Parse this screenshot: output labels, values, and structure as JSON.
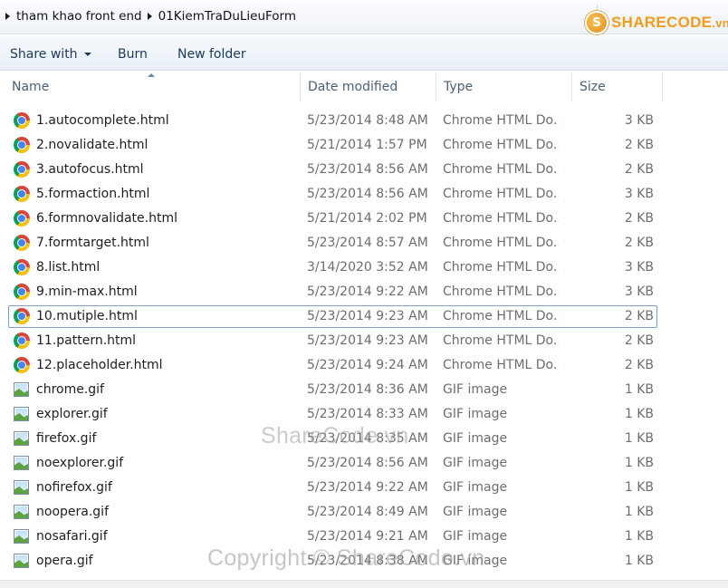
{
  "address_bar": {
    "crumbs": [
      "tham khao front end",
      "01KiemTraDuLieuForm"
    ]
  },
  "logo": {
    "badge": "S",
    "name": "SHARECODE",
    "tld": ".vn"
  },
  "toolbar": {
    "share_label": "Share with",
    "burn_label": "Burn",
    "new_folder_label": "New folder"
  },
  "columns": {
    "name": "Name",
    "date": "Date modified",
    "type": "Type",
    "size": "Size"
  },
  "files": [
    {
      "name": "1.autocomplete.html",
      "date": "5/23/2014 8:48 AM",
      "type": "Chrome HTML Do...",
      "size": "3 KB",
      "icon": "chrome-icon"
    },
    {
      "name": "2.novalidate.html",
      "date": "5/21/2014 1:57 PM",
      "type": "Chrome HTML Do...",
      "size": "2 KB",
      "icon": "chrome-icon"
    },
    {
      "name": "3.autofocus.html",
      "date": "5/23/2014 8:56 AM",
      "type": "Chrome HTML Do...",
      "size": "2 KB",
      "icon": "chrome-icon"
    },
    {
      "name": "5.formaction.html",
      "date": "5/23/2014 8:56 AM",
      "type": "Chrome HTML Do...",
      "size": "3 KB",
      "icon": "chrome-icon"
    },
    {
      "name": "6.formnovalidate.html",
      "date": "5/21/2014 2:02 PM",
      "type": "Chrome HTML Do...",
      "size": "2 KB",
      "icon": "chrome-icon"
    },
    {
      "name": "7.formtarget.html",
      "date": "5/23/2014 8:57 AM",
      "type": "Chrome HTML Do...",
      "size": "2 KB",
      "icon": "chrome-icon"
    },
    {
      "name": "8.list.html",
      "date": "3/14/2020 3:52 AM",
      "type": "Chrome HTML Do...",
      "size": "3 KB",
      "icon": "chrome-icon"
    },
    {
      "name": "9.min-max.html",
      "date": "5/23/2014 9:22 AM",
      "type": "Chrome HTML Do...",
      "size": "3 KB",
      "icon": "chrome-icon"
    },
    {
      "name": "10.mutiple.html",
      "date": "5/23/2014 9:23 AM",
      "type": "Chrome HTML Do...",
      "size": "2 KB",
      "icon": "chrome-icon",
      "selected": true
    },
    {
      "name": "11.pattern.html",
      "date": "5/23/2014 9:23 AM",
      "type": "Chrome HTML Do...",
      "size": "2 KB",
      "icon": "chrome-icon"
    },
    {
      "name": "12.placeholder.html",
      "date": "5/23/2014 9:24 AM",
      "type": "Chrome HTML Do...",
      "size": "2 KB",
      "icon": "chrome-icon"
    },
    {
      "name": "chrome.gif",
      "date": "5/23/2014 8:36 AM",
      "type": "GIF image",
      "size": "1 KB",
      "icon": "gif-image-icon"
    },
    {
      "name": "explorer.gif",
      "date": "5/23/2014 8:33 AM",
      "type": "GIF image",
      "size": "1 KB",
      "icon": "gif-image-icon"
    },
    {
      "name": "firefox.gif",
      "date": "5/23/2014 8:35 AM",
      "type": "GIF image",
      "size": "1 KB",
      "icon": "gif-image-icon"
    },
    {
      "name": "noexplorer.gif",
      "date": "5/23/2014 8:56 AM",
      "type": "GIF image",
      "size": "1 KB",
      "icon": "gif-image-icon"
    },
    {
      "name": "nofirefox.gif",
      "date": "5/23/2014 9:22 AM",
      "type": "GIF image",
      "size": "1 KB",
      "icon": "gif-image-icon"
    },
    {
      "name": "noopera.gif",
      "date": "5/23/2014 8:49 AM",
      "type": "GIF image",
      "size": "1 KB",
      "icon": "gif-image-icon"
    },
    {
      "name": "nosafari.gif",
      "date": "5/23/2014 9:21 AM",
      "type": "GIF image",
      "size": "1 KB",
      "icon": "gif-image-icon"
    },
    {
      "name": "opera.gif",
      "date": "5/23/2014 8:38 AM",
      "type": "GIF image",
      "size": "1 KB",
      "icon": "gif-image-icon"
    }
  ],
  "watermarks": {
    "center": "ShareCode.vn",
    "bottom": "Copyright © ShareCode.vn"
  },
  "colors": {
    "selection_border": "#7da2ce",
    "toolbar_text": "#1e395b",
    "header_text": "#4c607a",
    "logo_orange": "#f29b1d"
  }
}
